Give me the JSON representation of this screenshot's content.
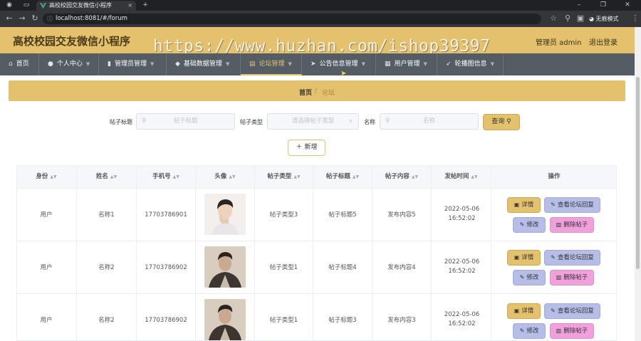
{
  "browser": {
    "tab_title": "高校校园交友微信小程序",
    "tab_close": "×",
    "new_tab": "+",
    "url": "localhost:8081/#/forum",
    "incognito_label": "无痕模式"
  },
  "header": {
    "app_title": "高校校园交友微信小程序",
    "admin_label": "管理员 admin",
    "logout_label": "退出登录",
    "watermark": "https://www.huzhan.com/ishop39397"
  },
  "menu": [
    {
      "label": "首页",
      "icon": "home-icon"
    },
    {
      "label": "个人中心",
      "icon": "user-icon"
    },
    {
      "label": "管理员管理",
      "icon": "admin-icon"
    },
    {
      "label": "基础数据管理",
      "icon": "data-icon"
    },
    {
      "label": "论坛管理",
      "icon": "forum-icon"
    },
    {
      "label": "公告信息管理",
      "icon": "notice-icon"
    },
    {
      "label": "用户管理",
      "icon": "users-icon"
    },
    {
      "label": "轮播图信息",
      "icon": "carousel-icon"
    }
  ],
  "breadcrumb": {
    "home": "首页",
    "separator": "/",
    "current": "论坛"
  },
  "search": {
    "title_label": "帖子标题",
    "title_placeholder": "帖子标题",
    "type_label": "帖子类型",
    "type_placeholder": "请选择帖子类型",
    "name_label": "名称",
    "name_placeholder": "名称",
    "search_button": "查询",
    "add_button": "新增"
  },
  "table": {
    "columns": [
      "身份",
      "姓名",
      "手机号",
      "头像",
      "帖子类型",
      "帖子标题",
      "帖子内容",
      "发帖时间",
      "操作"
    ],
    "rows": [
      {
        "role": "用户",
        "name": "名称1",
        "phone": "17703786901",
        "type": "帖子类型3",
        "title": "帖子标题5",
        "content": "发布内容5",
        "time": "2022-05-06 16:52:02"
      },
      {
        "role": "用户",
        "name": "名称2",
        "phone": "17703786902",
        "type": "帖子类型1",
        "title": "帖子标题4",
        "content": "发布内容4",
        "time": "2022-05-06 16:52:02"
      },
      {
        "role": "用户",
        "name": "名称2",
        "phone": "17703786902",
        "type": "帖子类型1",
        "title": "帖子标题3",
        "content": "发布内容3",
        "time": "2022-05-06 16:52:02"
      }
    ],
    "actions": {
      "detail": "详情",
      "reply": "查看论坛回复",
      "edit": "修改",
      "delete": "删除帖子"
    }
  },
  "colors": {
    "accent": "#e4c16c",
    "menu_bg": "#545c64",
    "reply_btn": "#b6bde7",
    "delete_btn": "#f0a1dc"
  }
}
